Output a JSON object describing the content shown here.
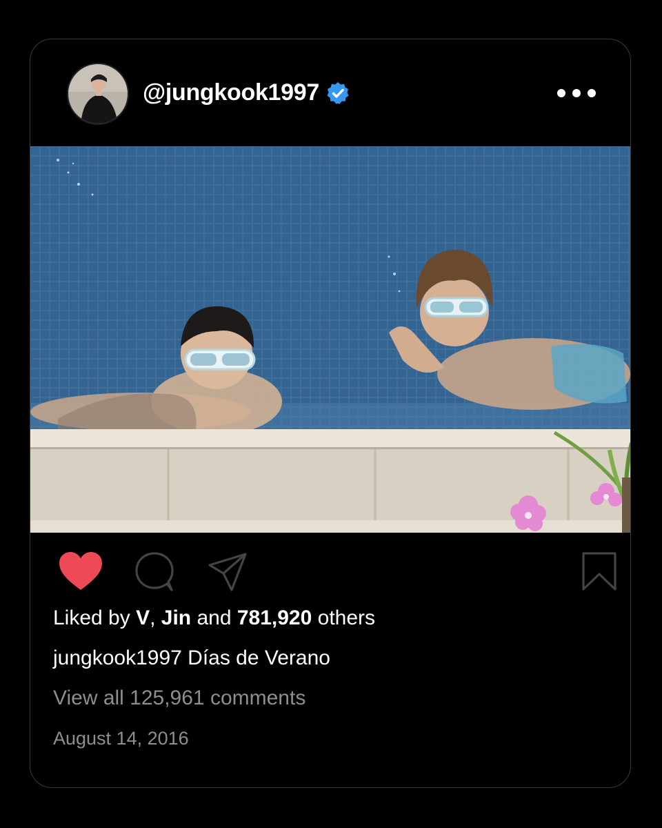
{
  "post": {
    "username": "@jungkook1997",
    "verified": true,
    "liked": true,
    "likes_prefix": "Liked by ",
    "liker_1": "V",
    "liker_sep": ", ",
    "liker_2": "Jin",
    "likes_and": " and ",
    "likes_count": "781,920",
    "likes_suffix": " others",
    "caption_user": "jungkook1997",
    "caption_text": " Días de Verano",
    "comments_link": "View all 125,961 comments",
    "date": "August 14, 2016"
  },
  "icons": {
    "more": "more-options-icon",
    "like": "heart-icon",
    "comment": "comment-icon",
    "share": "send-icon",
    "save": "bookmark-icon",
    "verified": "verified-badge-icon"
  },
  "colors": {
    "like": "#ed4956",
    "verified": "#3897f0",
    "muted_text": "#8e8e8e"
  }
}
